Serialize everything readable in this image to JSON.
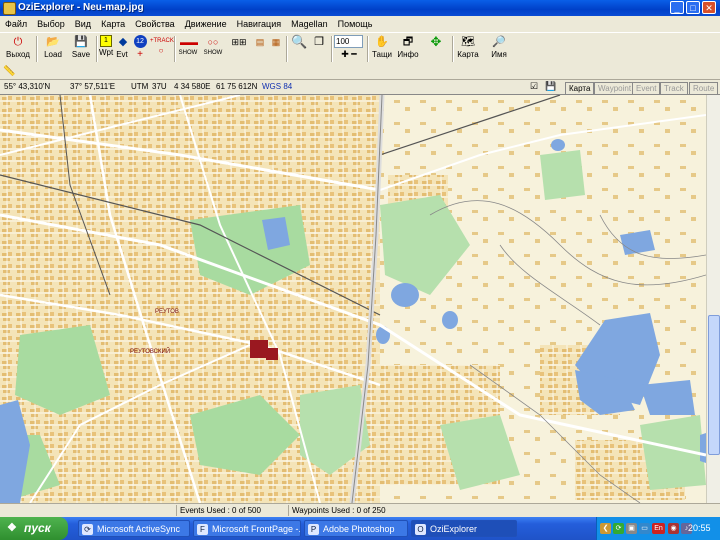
{
  "window": {
    "title": "OziExplorer - Neu-map.jpg"
  },
  "menu": [
    "Файл",
    "Выбор",
    "Вид",
    "Карта",
    "Свойства",
    "Движение",
    "Навигация",
    "Magellan",
    "Помощь"
  ],
  "toolbar": {
    "exit": "Выход",
    "load": "Load",
    "save": "Save",
    "wpt": "Wpt",
    "evt": "Evt",
    "track_badge": "12",
    "track": "+TRACK",
    "show": "SHOW",
    "zoom_value": "100",
    "pan": "Тащи",
    "info": "Инфо",
    "map": "Карта",
    "name": "Имя"
  },
  "coords": {
    "lat": "55° 43,310'N",
    "lon": "37° 57,511'E",
    "utm_label": "UTM",
    "zone": "37U",
    "easting": "4 34 580E",
    "northing": "61 75 612N",
    "datum": "WGS 84"
  },
  "view_tabs": [
    "Карта",
    "Waypoint",
    "Event",
    "Track",
    "Route"
  ],
  "map_labels": [
    "РЕУТОВ",
    "РЕУТОВСКИЙ"
  ],
  "status": {
    "events": "Events Used : 0 of 500",
    "waypoints": "Waypoints Used : 0 of 250"
  },
  "taskbar": {
    "start": "пуск",
    "tasks": [
      "Microsoft ActiveSync",
      "Microsoft FrontPage -...",
      "Adobe Photoshop",
      "OziExplorer"
    ],
    "lang": "En",
    "clock": "20:55"
  },
  "colors": {
    "water": "#7fa7e0",
    "park": "#a8dba0",
    "building": "#e8c27a",
    "road": "#ffffff",
    "highlight": "#9a1820"
  }
}
